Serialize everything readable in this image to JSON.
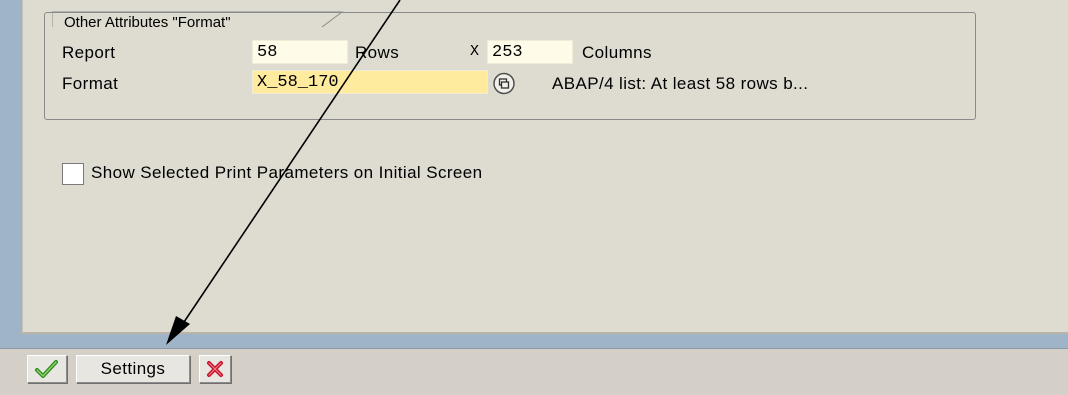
{
  "group": {
    "title": "Other Attributes \"Format\""
  },
  "report_row": {
    "label": "Report",
    "rows_value": "58",
    "rows_label": "Rows",
    "times": "X",
    "columns_value": "253",
    "columns_label": "Columns"
  },
  "format_row": {
    "label": "Format",
    "value": "X_58_170",
    "description": "ABAP/4 list: At least 58 rows b..."
  },
  "checkbox": {
    "label": "Show Selected Print Parameters on Initial Screen",
    "checked": false
  },
  "toolbar": {
    "settings_label": "Settings",
    "confirm_icon": "green-check-icon",
    "cancel_icon": "red-x-icon"
  },
  "colors": {
    "panel_background": "#dedbd1",
    "blue_bar": "#a0b4c8",
    "required_field": "#ffeb9e",
    "input_field": "#fffbe9"
  }
}
